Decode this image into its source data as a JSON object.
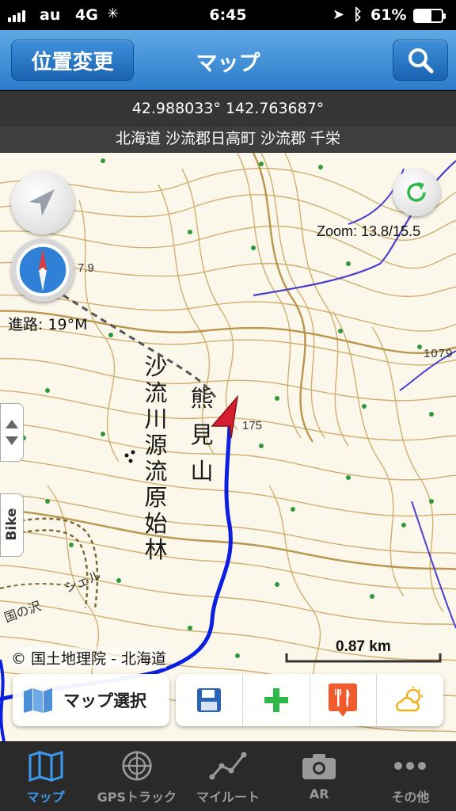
{
  "status_bar": {
    "carrier": "au",
    "network": "4G",
    "time": "6:45",
    "battery": "61%",
    "battery_level": 0.61
  },
  "nav": {
    "left_button": "位置変更",
    "title": "マップ",
    "right_icon": "search-icon"
  },
  "location": {
    "coordinates": "42.988033° 142.763687°",
    "address": "北海道 沙流郡日高町 沙流郡 千栄"
  },
  "map": {
    "zoom_text": "Zoom: 13.8/15.5",
    "heading_text": "進路: 19°M",
    "labels": {
      "mountain": [
        "熊",
        "見",
        "山"
      ],
      "forest": [
        "沙",
        "流",
        "川",
        "源",
        "流",
        "原",
        "始",
        "林"
      ],
      "elevation_175": "175",
      "elevation_1079": "1079",
      "elevation_79": "7.9",
      "stream": "国の沢",
      "road": "シェル"
    },
    "side_tab_label": "Bike",
    "attribution": "© 国土地理院 - 北海道",
    "scale": "0.87 km",
    "colors": {
      "track": "#0a1fe0",
      "marker": "#d42030",
      "contour": "#c9a35a",
      "river": "#4a3fd0"
    }
  },
  "toolbar": {
    "map_select_label": "マップ選択",
    "icons": [
      "save-icon",
      "add-icon",
      "restaurant-icon",
      "weather-icon"
    ]
  },
  "tabs": [
    {
      "label": "マップ",
      "icon": "map-icon",
      "active": true
    },
    {
      "label": "GPSトラック",
      "icon": "radar-icon",
      "active": false
    },
    {
      "label": "マイルート",
      "icon": "route-icon",
      "active": false
    },
    {
      "label": "AR",
      "icon": "camera-icon",
      "active": false
    },
    {
      "label": "その他",
      "icon": "more-icon",
      "active": false
    }
  ]
}
